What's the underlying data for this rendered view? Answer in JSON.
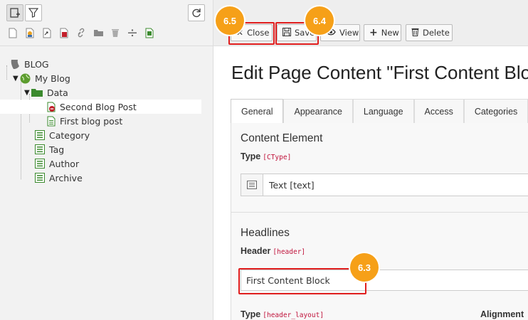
{
  "tree": {
    "root": "BLOG",
    "site": "My Blog",
    "folder": "Data",
    "items": [
      {
        "label": "Second Blog Post"
      },
      {
        "label": "First blog post"
      },
      {
        "label": "Category"
      },
      {
        "label": "Tag"
      },
      {
        "label": "Author"
      },
      {
        "label": "Archive"
      }
    ]
  },
  "toolbar": {
    "close_label": "Close",
    "save_label": "Save",
    "view_label": "View",
    "new_label": "New",
    "delete_label": "Delete"
  },
  "badges": {
    "close": "6.5",
    "save": "6.4",
    "header": "6.3"
  },
  "page": {
    "title": "Edit Page Content \"First Content Block"
  },
  "tabs": [
    "General",
    "Appearance",
    "Language",
    "Access",
    "Categories"
  ],
  "form": {
    "content_element_title": "Content Element",
    "type_label": "Type",
    "type_code": "[CType]",
    "type_value": "Text [text]",
    "headlines_title": "Headlines",
    "header_label": "Header",
    "header_code": "[header]",
    "header_value": "First Content Block",
    "layout_label": "Type",
    "layout_code": "[header_layout]",
    "alignment_label": "Alignment"
  },
  "colors": {
    "highlight": "#e01e1e",
    "badge": "#f6a018"
  }
}
